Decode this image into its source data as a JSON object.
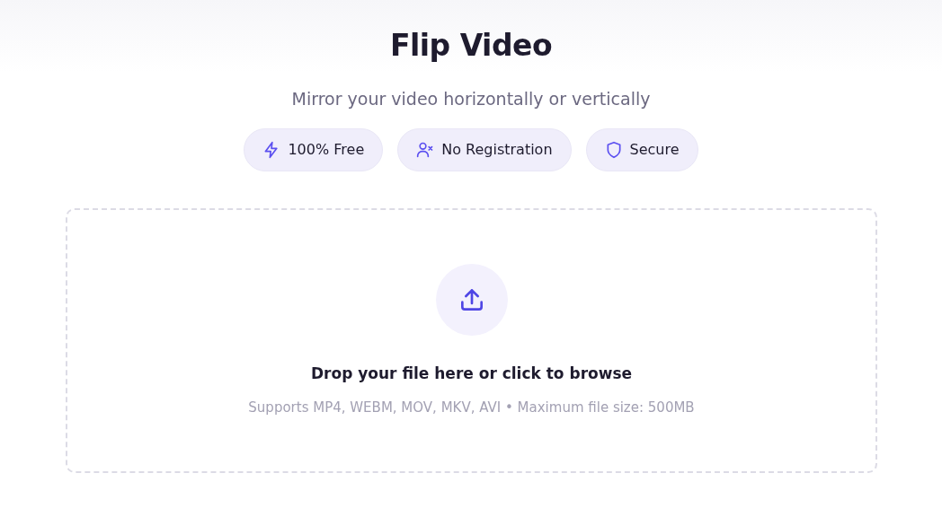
{
  "title": "Flip Video",
  "subtitle": "Mirror your video horizontally or vertically",
  "badges": [
    {
      "kind": "bolt",
      "label": "100% Free"
    },
    {
      "kind": "user-x",
      "label": "No Registration"
    },
    {
      "kind": "shield",
      "label": "Secure"
    }
  ],
  "dropzone": {
    "prompt": "Drop your file here or click to browse",
    "hint": "Supports MP4, WEBM, MOV, MKV, AVI • Maximum file size: 500MB"
  }
}
